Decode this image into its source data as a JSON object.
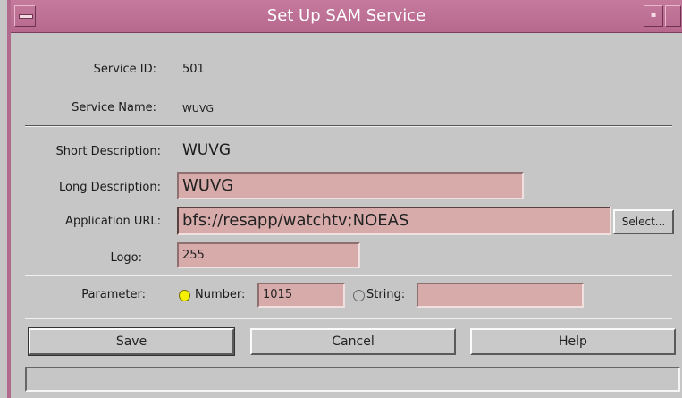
{
  "window": {
    "title": "Set Up SAM Service"
  },
  "form": {
    "service_id_label": "Service ID:",
    "service_id_value": "501",
    "service_name_label": "Service Name:",
    "service_name_value": "WUVG",
    "short_desc_label": "Short Description:",
    "short_desc_value": "WUVG",
    "long_desc_label": "Long Description:",
    "long_desc_value": "WUVG",
    "app_url_label": "Application URL:",
    "app_url_value": "bfs://resapp/watchtv;NOEAS",
    "select_label": "Select...",
    "logo_label": "Logo:",
    "logo_value": "255",
    "parameter_label": "Parameter:",
    "number_label": "Number:",
    "number_value": "1015",
    "number_selected": true,
    "string_label": "String:",
    "string_value": ""
  },
  "buttons": {
    "save": "Save",
    "cancel": "Cancel",
    "help": "Help"
  },
  "colors": {
    "titlebar": "#b7688e",
    "field_bg": "#d8abab",
    "window_bg": "#c6c6c6",
    "radio_on": "#f4f000"
  }
}
